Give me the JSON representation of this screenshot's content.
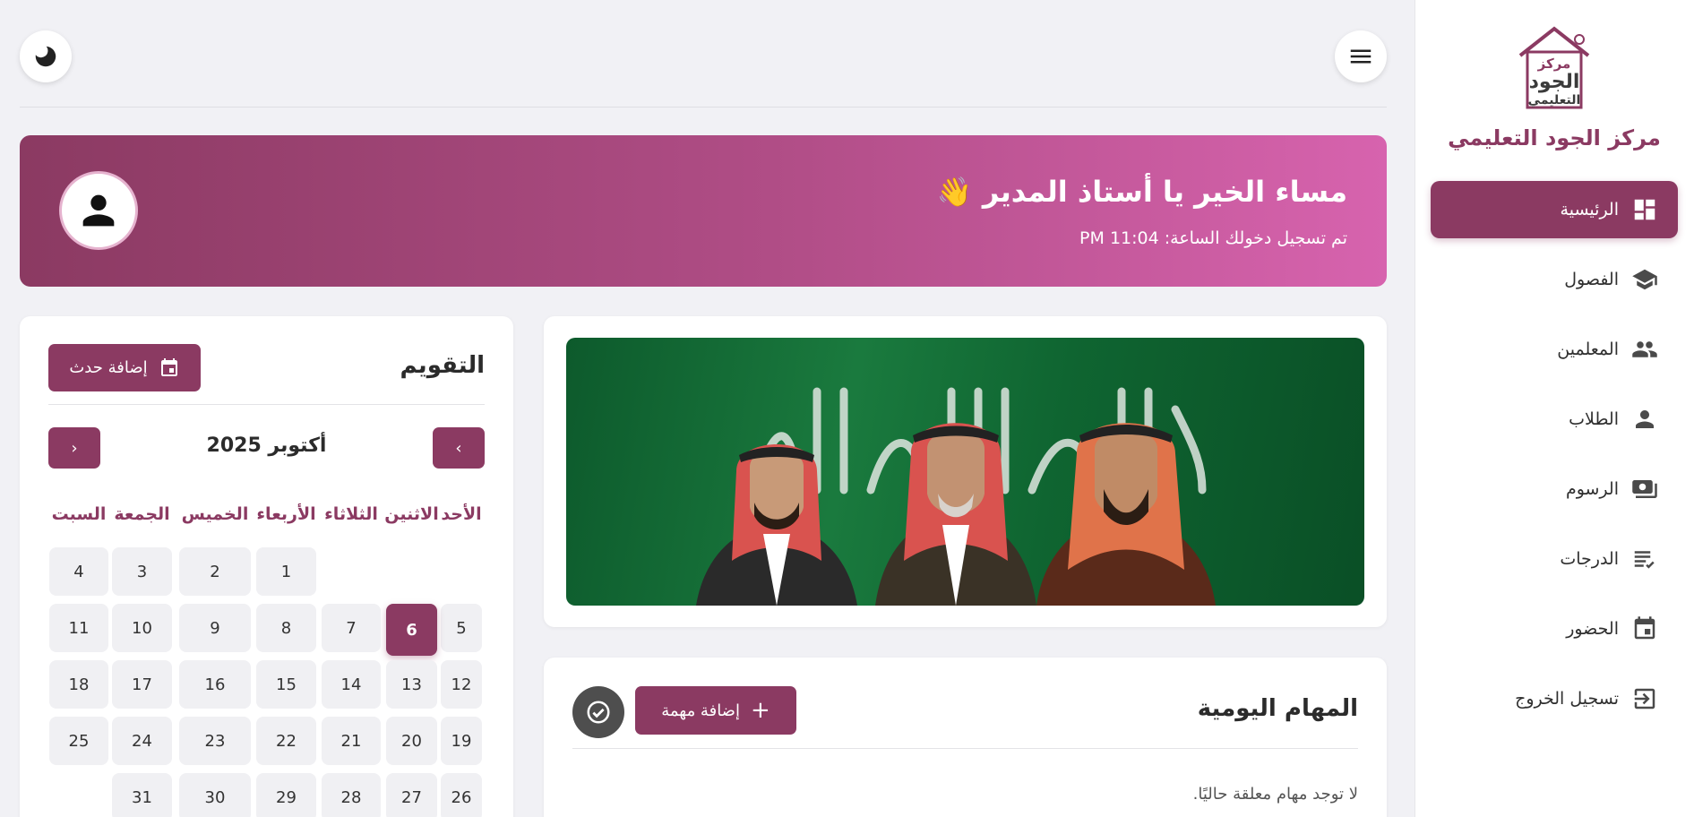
{
  "brand": {
    "name": "مركز الجود التعليمي",
    "logo_text": [
      "مركز",
      "الجود",
      "التعليمي"
    ]
  },
  "sidebar": {
    "items": [
      {
        "label": "الرئيسية",
        "icon": "dashboard-icon",
        "active": true
      },
      {
        "label": "الفصول",
        "icon": "graduation-cap-icon",
        "active": false
      },
      {
        "label": "المعلمين",
        "icon": "group-icon",
        "active": false
      },
      {
        "label": "الطلاب",
        "icon": "person-icon",
        "active": false
      },
      {
        "label": "الرسوم",
        "icon": "payments-icon",
        "active": false
      },
      {
        "label": "الدرجات",
        "icon": "list-icon",
        "active": false
      },
      {
        "label": "الحضور",
        "icon": "calendar-icon",
        "active": false
      },
      {
        "label": "تسجيل الخروج",
        "icon": "logout-icon",
        "active": false
      }
    ]
  },
  "topbar": {
    "menu_icon": "hamburger-menu-icon",
    "theme_icon": "moon-icon"
  },
  "welcome": {
    "greeting": "مساء الخير يا أستاذ المدير 👋",
    "login_time": "تم تسجيل دخولك الساعة: 11:04 PM",
    "avatar_icon": "user-avatar-icon"
  },
  "tasks": {
    "title": "المهام اليومية",
    "add_button": "إضافة مهمة",
    "empty_text": "لا توجد مهام معلقة حاليًا."
  },
  "calendar": {
    "title": "التقويم",
    "add_event": "إضافة حدث",
    "month_label": "أكتوبر 2025",
    "weekdays": [
      "الأحد",
      "الاثنين",
      "الثلاثاء",
      "الأربعاء",
      "الخميس",
      "الجمعة",
      "السبت"
    ],
    "weeks": [
      [
        "",
        "",
        "",
        "1",
        "2",
        "3",
        "4"
      ],
      [
        "5",
        "6",
        "7",
        "8",
        "9",
        "10",
        "11"
      ],
      [
        "12",
        "13",
        "14",
        "15",
        "16",
        "17",
        "18"
      ],
      [
        "19",
        "20",
        "21",
        "22",
        "23",
        "24",
        "25"
      ],
      [
        "26",
        "27",
        "28",
        "29",
        "30",
        "31",
        ""
      ]
    ],
    "today": "6"
  },
  "colors": {
    "accent": "#8b3a62",
    "gradient_end": "#d763ae",
    "flag_green": "#0f6531"
  }
}
